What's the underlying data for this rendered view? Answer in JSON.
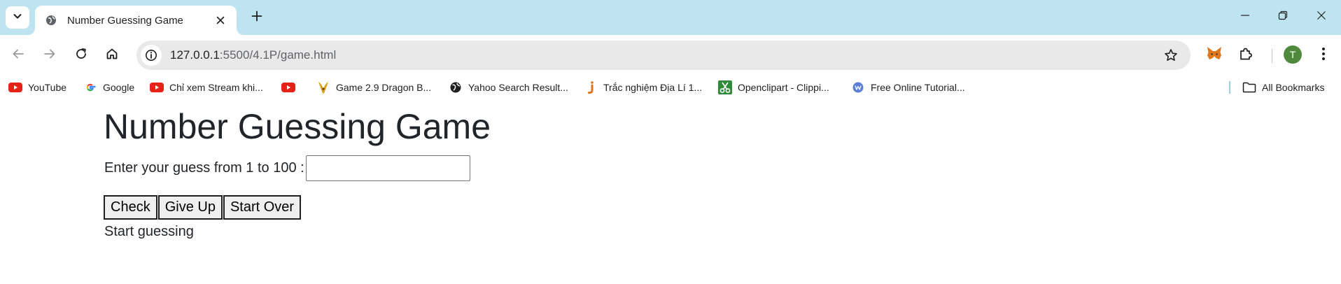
{
  "browser": {
    "tab": {
      "title": "Number Guessing Game"
    },
    "url": {
      "host": "127.0.0.1",
      "path": ":5500/4.1P/game.html"
    },
    "profile_initial": "T",
    "bookmarks": [
      {
        "label": "YouTube",
        "icon": "youtube-icon"
      },
      {
        "label": "Google",
        "icon": "google-icon"
      },
      {
        "label": "Chỉ xem Stream khi...",
        "icon": "youtube-icon"
      },
      {
        "label": "",
        "icon": "youtube-icon"
      },
      {
        "label": "Game 2.9 Dragon B...",
        "icon": "dragon-icon"
      },
      {
        "label": "Yahoo Search Result...",
        "icon": "globe-icon"
      },
      {
        "label": "Trắc nghiệm Địa Lí 1...",
        "icon": "j-icon"
      },
      {
        "label": "Openclipart - Clippi...",
        "icon": "scissors-icon"
      },
      {
        "label": "Free Online Tutorial...",
        "icon": "w-icon"
      }
    ],
    "all_bookmarks_label": "All Bookmarks"
  },
  "page": {
    "title": "Number Guessing Game",
    "guess_label": "Enter your guess from 1 to 100 :",
    "guess_value": "",
    "buttons": {
      "check": "Check",
      "give_up": "Give Up",
      "start_over": "Start Over"
    },
    "status": "Start guessing"
  },
  "colors": {
    "tabstrip_bg": "#bde4f0",
    "omnibox_bg": "#e9e9e9",
    "avatar_bg": "#4f8a3c",
    "youtube_red": "#e62117"
  }
}
